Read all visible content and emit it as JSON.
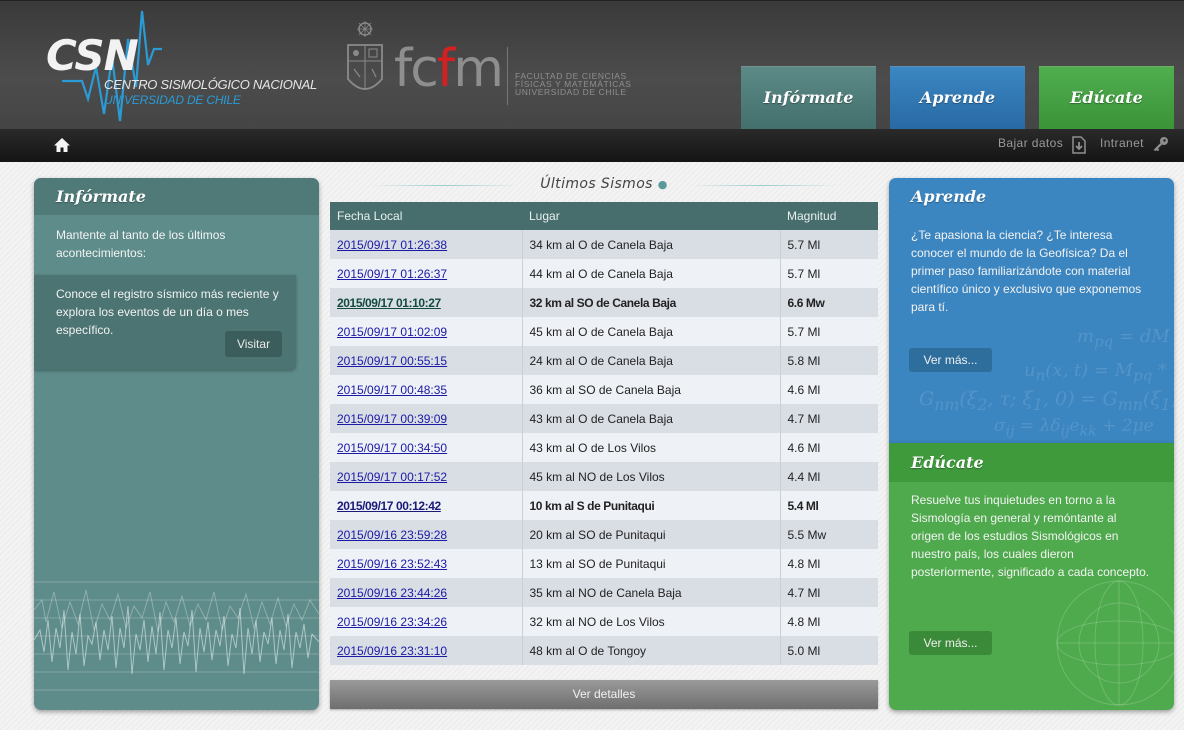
{
  "header": {
    "csn_mark": "CSN",
    "csn_name": "CENTRO SISMOLÓGICO NACIONAL",
    "csn_university": "UNIVERSIDAD DE CHILE",
    "fcfm_logo": "fcfm",
    "fcfm_text_1": "FACULTAD DE CIENCIAS",
    "fcfm_text_2": "FÍSICAS Y MATEMÁTICAS",
    "fcfm_text_3": "UNIVERSIDAD DE CHILE",
    "tabs": [
      {
        "label": "Infórmate",
        "color": "#5b8a87"
      },
      {
        "label": "Aprende",
        "color": "#3b87c2"
      },
      {
        "label": "Edúcate",
        "color": "#50ae4f"
      }
    ]
  },
  "toolbar": {
    "home_icon": "home-icon",
    "download_label": "Bajar datos",
    "download_icon": "download-icon",
    "intranet_label": "Intranet",
    "intranet_icon": "key-icon"
  },
  "informate": {
    "title": "Infórmate",
    "text": "Mantente al tanto de los últimos acontecimientos:",
    "box_text": "Conoce el registro sísmico más reciente y explora los eventos de un día o mes específico.",
    "visit_label": "Visitar"
  },
  "center": {
    "title": "Últimos Sismos",
    "columns": [
      "Fecha Local",
      "Lugar",
      "Magnitud"
    ],
    "details_label": "Ver detalles",
    "rows": [
      {
        "date": "2015/09/17 01:26:38",
        "place": "34 km al O de Canela Baja",
        "mag": "5.7 Ml",
        "bold": false
      },
      {
        "date": "2015/09/17 01:26:37",
        "place": "44 km al O de Canela Baja",
        "mag": "5.7 Ml",
        "bold": false
      },
      {
        "date": "2015/09/17 01:10:27",
        "place": "32 km al SO de Canela Baja",
        "mag": "6.6 Mw",
        "bold": true
      },
      {
        "date": "2015/09/17 01:02:09",
        "place": "45 km al O de Canela Baja",
        "mag": "5.7 Ml",
        "bold": false
      },
      {
        "date": "2015/09/17 00:55:15",
        "place": "24 km al O de Canela Baja",
        "mag": "5.8 Ml",
        "bold": false
      },
      {
        "date": "2015/09/17 00:48:35",
        "place": "36 km al SO de Canela Baja",
        "mag": "4.6 Ml",
        "bold": false
      },
      {
        "date": "2015/09/17 00:39:09",
        "place": "43 km al O de Canela Baja",
        "mag": "4.7 Ml",
        "bold": false
      },
      {
        "date": "2015/09/17 00:34:50",
        "place": "43 km al O de Los Vilos",
        "mag": "4.6 Ml",
        "bold": false
      },
      {
        "date": "2015/09/17 00:17:52",
        "place": "45 km al NO de Los Vilos",
        "mag": "4.4 Ml",
        "bold": false
      },
      {
        "date": "2015/09/17 00:12:42",
        "place": "10 km al S de Punitaqui",
        "mag": "5.4 Ml",
        "bold": true
      },
      {
        "date": "2015/09/16 23:59:28",
        "place": "20 km al SO de Punitaqui",
        "mag": "5.5 Mw",
        "bold": false
      },
      {
        "date": "2015/09/16 23:52:43",
        "place": "13 km al SO de Punitaqui",
        "mag": "4.8 Ml",
        "bold": false
      },
      {
        "date": "2015/09/16 23:44:26",
        "place": "35 km al NO de Canela Baja",
        "mag": "4.7 Ml",
        "bold": false
      },
      {
        "date": "2015/09/16 23:34:26",
        "place": "32 km al NO de Los Vilos",
        "mag": "4.8 Ml",
        "bold": false
      },
      {
        "date": "2015/09/16 23:31:10",
        "place": "48 km al O de Tongoy",
        "mag": "5.0 Ml",
        "bold": false
      }
    ]
  },
  "aprende": {
    "title": "Aprende",
    "text": "¿Te apasiona la ciencia? ¿Te interesa conocer el mundo de la Geofísica? Da el primer paso familiarizándote con material científico único y exclusivo que exponemos para tí.",
    "more_label": "Ver más..."
  },
  "educate": {
    "title": "Edúcate",
    "text": "Resuelve tus inquietudes en torno a la Sismología en general y remóntante al origen de los estudios Sismológicos en nuestro país, los cuales dieron posteriormente, significado a cada concepto.",
    "more_label": "Ver más..."
  }
}
